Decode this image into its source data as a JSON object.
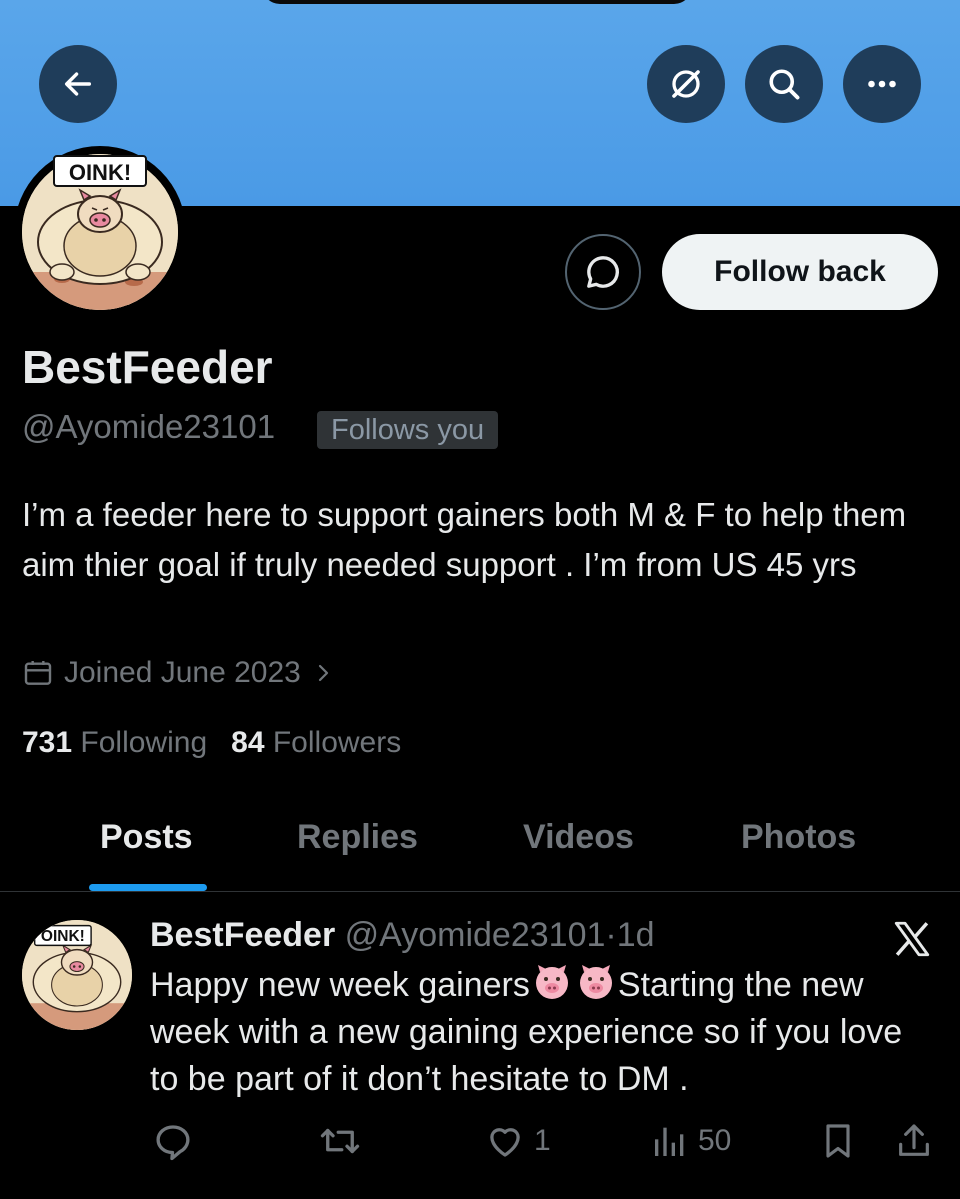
{
  "header": {
    "back_icon": "arrow-left-icon",
    "grok_icon": "grok-icon",
    "search_icon": "search-icon",
    "more_icon": "more-horizontal-icon",
    "banner_color": "#4a9ae6"
  },
  "profile": {
    "avatar_text": "OINK!",
    "display_name": "BestFeeder",
    "handle": "@Ayomide23101",
    "follows_you_badge": "Follows you",
    "follow_button_label": "Follow back",
    "bio": "I’m a feeder here to support gainers both M & F to help them aim thier goal if truly needed support . I’m from US 45 yrs",
    "joined": "Joined June 2023",
    "following_count": "731",
    "following_label": "Following",
    "followers_count": "84",
    "followers_label": "Followers"
  },
  "tabs": [
    {
      "label": "Posts",
      "active": true
    },
    {
      "label": "Replies",
      "active": false
    },
    {
      "label": "Videos",
      "active": false
    },
    {
      "label": "Photos",
      "active": false
    }
  ],
  "post": {
    "avatar_text": "OINK!",
    "author_name": "BestFeeder",
    "author_handle": "@Ayomide23101",
    "separator": "·",
    "time": "1d",
    "text_part1": "Happy new week gainers",
    "text_part2": "Starting the new week with a new gaining experience so if you love to be part of it don’t hesitate to DM .",
    "likes": "1",
    "views": "50"
  },
  "colors": {
    "accent": "#1d9bf0",
    "muted": "#71767b",
    "text": "#e7e9ea",
    "background": "#000000"
  }
}
